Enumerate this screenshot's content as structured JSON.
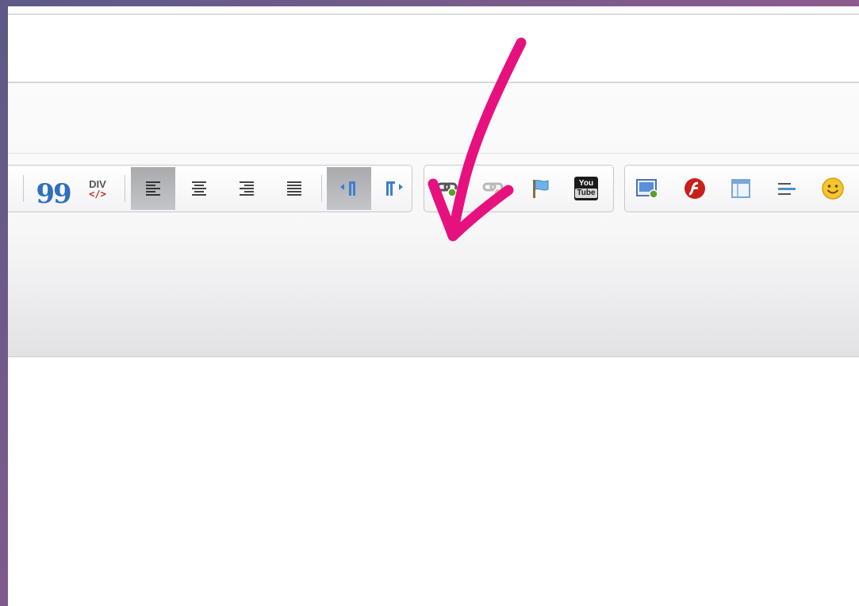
{
  "toolbar": {
    "blockquote": {
      "glyph": "❞"
    },
    "insert_div": {
      "label": "DIV",
      "code": "</>"
    },
    "alignment": [
      "align-left-icon",
      "align-center-icon",
      "align-right-icon",
      "align-justify-icon"
    ],
    "direction": [
      "direction-ltr-icon",
      "direction-rtl-icon"
    ],
    "links": [
      "link-icon",
      "unlink-icon",
      "anchor-flag-icon",
      "youtube-icon"
    ],
    "media": [
      "image-icon",
      "flash-icon",
      "table-icon",
      "horizontal-line-icon",
      "smiley-icon"
    ],
    "youtube": {
      "line1": "You",
      "line2": "Tube"
    }
  },
  "annotation": {
    "arrow_color": "#e6117f"
  }
}
